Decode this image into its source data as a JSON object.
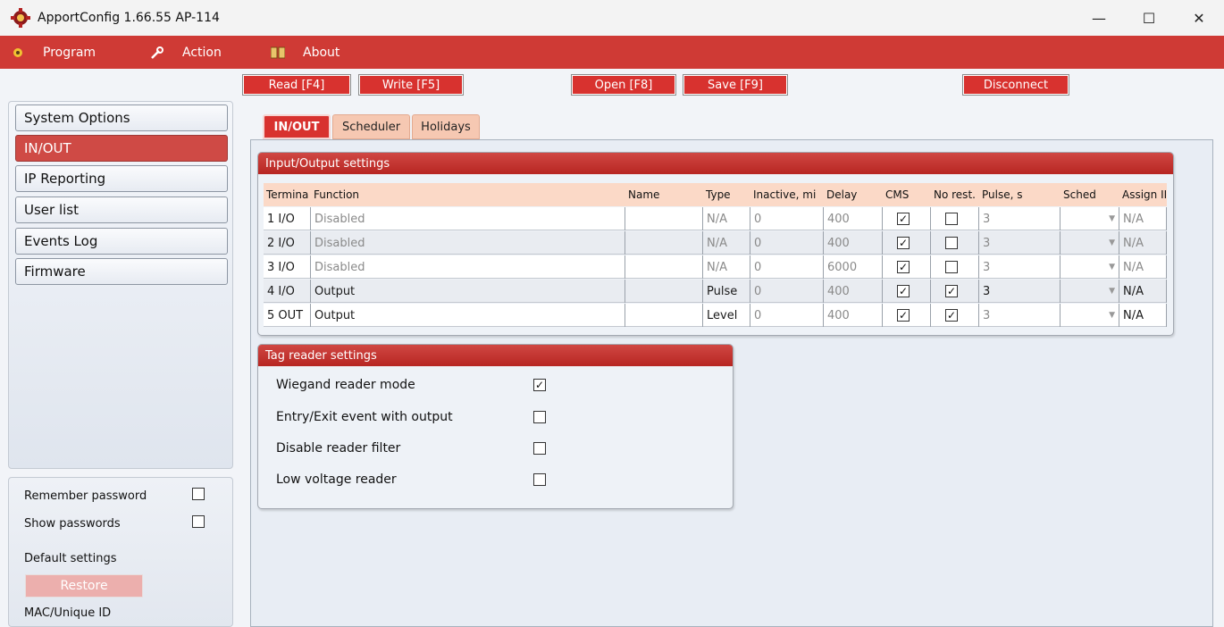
{
  "window": {
    "title": "ApportConfig 1.66.55   AP-114",
    "minimize": "—",
    "maximize": "☐",
    "close": "✕"
  },
  "menu": {
    "program": "Program",
    "action": "Action",
    "about": "About"
  },
  "toolbar": {
    "read": "Read [F4]",
    "write": "Write [F5]",
    "open": "Open [F8]",
    "save": "Save [F9]",
    "disconnect": "Disconnect"
  },
  "sidebar": {
    "items": [
      {
        "label": "System Options"
      },
      {
        "label": "IN/OUT"
      },
      {
        "label": "IP Reporting"
      },
      {
        "label": "User list"
      },
      {
        "label": "Events Log"
      },
      {
        "label": "Firmware"
      }
    ],
    "active_index": 1
  },
  "options": {
    "remember_password": "Remember password",
    "remember_password_checked": false,
    "show_passwords": "Show passwords",
    "show_passwords_checked": false,
    "default_settings": "Default settings",
    "restore": "Restore",
    "mac_label": "MAC/Unique ID"
  },
  "tabs": [
    {
      "label": "IN/OUT",
      "active": true
    },
    {
      "label": "Scheduler",
      "active": false
    },
    {
      "label": "Holidays",
      "active": false
    }
  ],
  "io_settings": {
    "title": "Input/Output settings",
    "columns": [
      "Termina",
      "Function",
      "Name",
      "Type",
      "Inactive, mi",
      "Delay",
      "CMS",
      "No rest.",
      "Pulse, s",
      "Sched",
      "Assign II"
    ],
    "rows": [
      {
        "terminal": "1 I/O",
        "function": "Disabled",
        "name": "",
        "type": "N/A",
        "inactive": "0",
        "delay": "400",
        "cms": true,
        "no_rest": false,
        "pulse": "3",
        "sched": "",
        "assign": "N/A",
        "enabled": false
      },
      {
        "terminal": "2 I/O",
        "function": "Disabled",
        "name": "",
        "type": "N/A",
        "inactive": "0",
        "delay": "400",
        "cms": true,
        "no_rest": false,
        "pulse": "3",
        "sched": "",
        "assign": "N/A",
        "enabled": false
      },
      {
        "terminal": "3 I/O",
        "function": "Disabled",
        "name": "",
        "type": "N/A",
        "inactive": "0",
        "delay": "6000",
        "cms": true,
        "no_rest": false,
        "pulse": "3",
        "sched": "",
        "assign": "N/A",
        "enabled": false
      },
      {
        "terminal": "4 I/O",
        "function": "Output",
        "name": "",
        "type": "Pulse",
        "inactive": "0",
        "delay": "400",
        "cms": true,
        "no_rest": true,
        "pulse": "3",
        "sched": "",
        "assign": "N/A",
        "enabled": true
      },
      {
        "terminal": "5 OUT",
        "function": "Output",
        "name": "",
        "type": "Level",
        "inactive": "0",
        "delay": "400",
        "cms": true,
        "no_rest": true,
        "pulse": "3",
        "sched": "",
        "assign": "N/A",
        "enabled": true
      }
    ]
  },
  "tag_reader": {
    "title": "Tag reader settings",
    "options": [
      {
        "label": "Wiegand reader mode",
        "checked": true
      },
      {
        "label": "Entry/Exit event with output",
        "checked": false
      },
      {
        "label": "Disable reader filter",
        "checked": false
      },
      {
        "label": "Low voltage reader",
        "checked": false
      }
    ]
  },
  "colors": {
    "accent_red": "#cf3a35",
    "tab_inactive": "#f6c8b2",
    "header_peach": "#fbd9c7"
  }
}
